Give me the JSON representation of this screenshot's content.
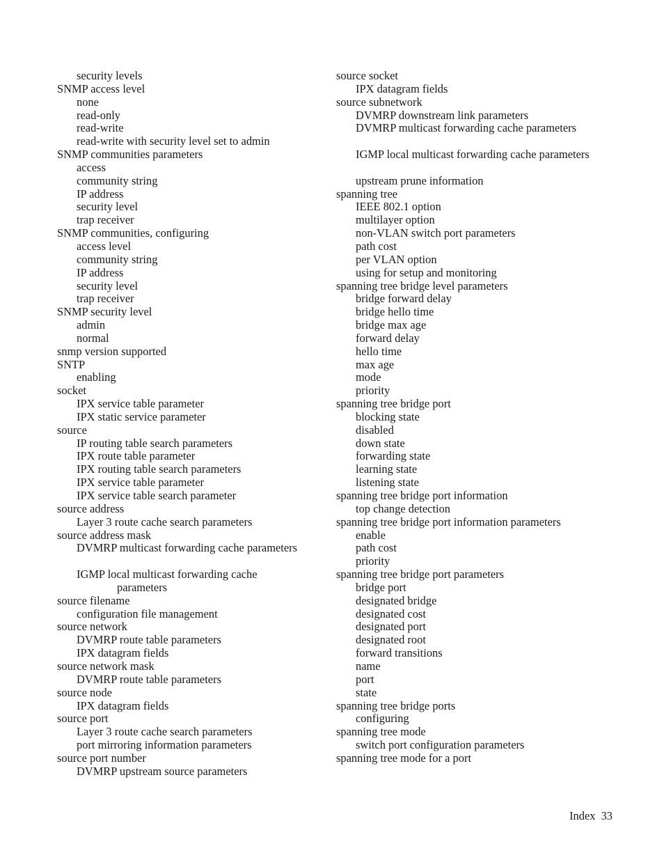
{
  "document": {
    "kind": "book-index-page",
    "footer": {
      "label": "Index",
      "page_number": "33",
      "text": "Index  33"
    }
  },
  "columns": {
    "left": {
      "entries": [
        {
          "level": 1,
          "text": "security levels"
        },
        {
          "level": 0,
          "text": "SNMP access level"
        },
        {
          "level": 1,
          "text": "none"
        },
        {
          "level": 1,
          "text": "read-only"
        },
        {
          "level": 1,
          "text": "read-write"
        },
        {
          "level": 1,
          "text": "read-write with security level set to admin"
        },
        {
          "level": 0,
          "text": "SNMP communities parameters"
        },
        {
          "level": 1,
          "text": "access"
        },
        {
          "level": 1,
          "text": "community string"
        },
        {
          "level": 1,
          "text": "IP address"
        },
        {
          "level": 1,
          "text": "security level"
        },
        {
          "level": 1,
          "text": "trap receiver"
        },
        {
          "level": 0,
          "text": "SNMP communities, configuring"
        },
        {
          "level": 1,
          "text": "access level"
        },
        {
          "level": 1,
          "text": "community string"
        },
        {
          "level": 1,
          "text": "IP address"
        },
        {
          "level": 1,
          "text": "security level"
        },
        {
          "level": 1,
          "text": "trap receiver"
        },
        {
          "level": 0,
          "text": "SNMP security level"
        },
        {
          "level": 1,
          "text": "admin"
        },
        {
          "level": 1,
          "text": "normal"
        },
        {
          "level": 0,
          "text": "snmp version supported"
        },
        {
          "level": 0,
          "text": "SNTP"
        },
        {
          "level": 1,
          "text": "enabling"
        },
        {
          "level": 0,
          "text": "socket"
        },
        {
          "level": 1,
          "text": "IPX service table parameter"
        },
        {
          "level": 1,
          "text": "IPX static service parameter"
        },
        {
          "level": 0,
          "text": "source"
        },
        {
          "level": 1,
          "text": "IP routing table search parameters"
        },
        {
          "level": 1,
          "text": "IPX route table parameter"
        },
        {
          "level": 1,
          "text": "IPX routing table search parameters"
        },
        {
          "level": 1,
          "text": "IPX service table parameter"
        },
        {
          "level": 1,
          "text": "IPX service table search parameter"
        },
        {
          "level": 0,
          "text": "source address"
        },
        {
          "level": 1,
          "text": "Layer 3 route cache search parameters"
        },
        {
          "level": 0,
          "text": "source address mask"
        },
        {
          "level": 1,
          "text": "DVMRP multicast forwarding cache parameters"
        },
        {
          "level": 1,
          "text": "",
          "blank": true
        },
        {
          "level": 1,
          "text": "IGMP local multicast forwarding cache"
        },
        {
          "level": 3,
          "text": "parameters"
        },
        {
          "level": 0,
          "text": "source filename"
        },
        {
          "level": 1,
          "text": "configuration file management"
        },
        {
          "level": 0,
          "text": "source network"
        },
        {
          "level": 1,
          "text": "DVMRP route table parameters"
        },
        {
          "level": 1,
          "text": "IPX datagram fields"
        },
        {
          "level": 0,
          "text": "source network mask"
        },
        {
          "level": 1,
          "text": "DVMRP route table parameters"
        },
        {
          "level": 0,
          "text": "source node"
        },
        {
          "level": 1,
          "text": "IPX datagram fields"
        },
        {
          "level": 0,
          "text": "source port"
        },
        {
          "level": 1,
          "text": "Layer 3 route cache search parameters"
        },
        {
          "level": 1,
          "text": "port mirroring information parameters"
        },
        {
          "level": 0,
          "text": "source port number"
        },
        {
          "level": 1,
          "text": "DVMRP upstream source parameters"
        }
      ]
    },
    "right": {
      "entries": [
        {
          "level": 0,
          "text": "source socket"
        },
        {
          "level": 1,
          "text": "IPX datagram fields"
        },
        {
          "level": 0,
          "text": "source subnetwork"
        },
        {
          "level": 1,
          "text": "DVMRP downstream link parameters"
        },
        {
          "level": 1,
          "text": "DVMRP multicast forwarding cache parameters"
        },
        {
          "level": 1,
          "text": "",
          "blank": true
        },
        {
          "level": 1,
          "text": "IGMP local multicast forwarding cache parameters"
        },
        {
          "level": 1,
          "text": "",
          "blank": true
        },
        {
          "level": 1,
          "text": "upstream prune information"
        },
        {
          "level": 0,
          "text": "spanning tree"
        },
        {
          "level": 1,
          "text": "IEEE 802.1 option"
        },
        {
          "level": 1,
          "text": "multilayer option"
        },
        {
          "level": 1,
          "text": "non-VLAN switch port parameters"
        },
        {
          "level": 1,
          "text": "path cost"
        },
        {
          "level": 1,
          "text": "per VLAN option"
        },
        {
          "level": 1,
          "text": "using for setup and monitoring"
        },
        {
          "level": 0,
          "text": "spanning tree bridge level parameters"
        },
        {
          "level": 1,
          "text": "bridge forward delay"
        },
        {
          "level": 1,
          "text": "bridge hello time"
        },
        {
          "level": 1,
          "text": "bridge max age"
        },
        {
          "level": 1,
          "text": "forward delay"
        },
        {
          "level": 1,
          "text": "hello time"
        },
        {
          "level": 1,
          "text": "max age"
        },
        {
          "level": 1,
          "text": "mode"
        },
        {
          "level": 1,
          "text": "priority"
        },
        {
          "level": 0,
          "text": "spanning tree bridge port"
        },
        {
          "level": 1,
          "text": "blocking state"
        },
        {
          "level": 1,
          "text": "disabled"
        },
        {
          "level": 1,
          "text": "down state"
        },
        {
          "level": 1,
          "text": "forwarding state"
        },
        {
          "level": 1,
          "text": "learning state"
        },
        {
          "level": 1,
          "text": "listening state"
        },
        {
          "level": 0,
          "text": "spanning tree bridge port information"
        },
        {
          "level": 1,
          "text": "top change detection"
        },
        {
          "level": 0,
          "text": "spanning tree bridge port information parameters"
        },
        {
          "level": 1,
          "text": "enable"
        },
        {
          "level": 1,
          "text": "path cost"
        },
        {
          "level": 1,
          "text": "priority"
        },
        {
          "level": 0,
          "text": "spanning tree bridge port parameters"
        },
        {
          "level": 1,
          "text": "bridge port"
        },
        {
          "level": 1,
          "text": "designated bridge"
        },
        {
          "level": 1,
          "text": "designated cost"
        },
        {
          "level": 1,
          "text": "designated port"
        },
        {
          "level": 1,
          "text": "designated root"
        },
        {
          "level": 1,
          "text": "forward transitions"
        },
        {
          "level": 1,
          "text": "name"
        },
        {
          "level": 1,
          "text": "port"
        },
        {
          "level": 1,
          "text": "state"
        },
        {
          "level": 0,
          "text": "spanning tree bridge ports"
        },
        {
          "level": 1,
          "text": "configuring"
        },
        {
          "level": 0,
          "text": "spanning tree mode"
        },
        {
          "level": 1,
          "text": "switch port configuration parameters"
        },
        {
          "level": 0,
          "text": "spanning tree mode for a port"
        }
      ]
    }
  }
}
